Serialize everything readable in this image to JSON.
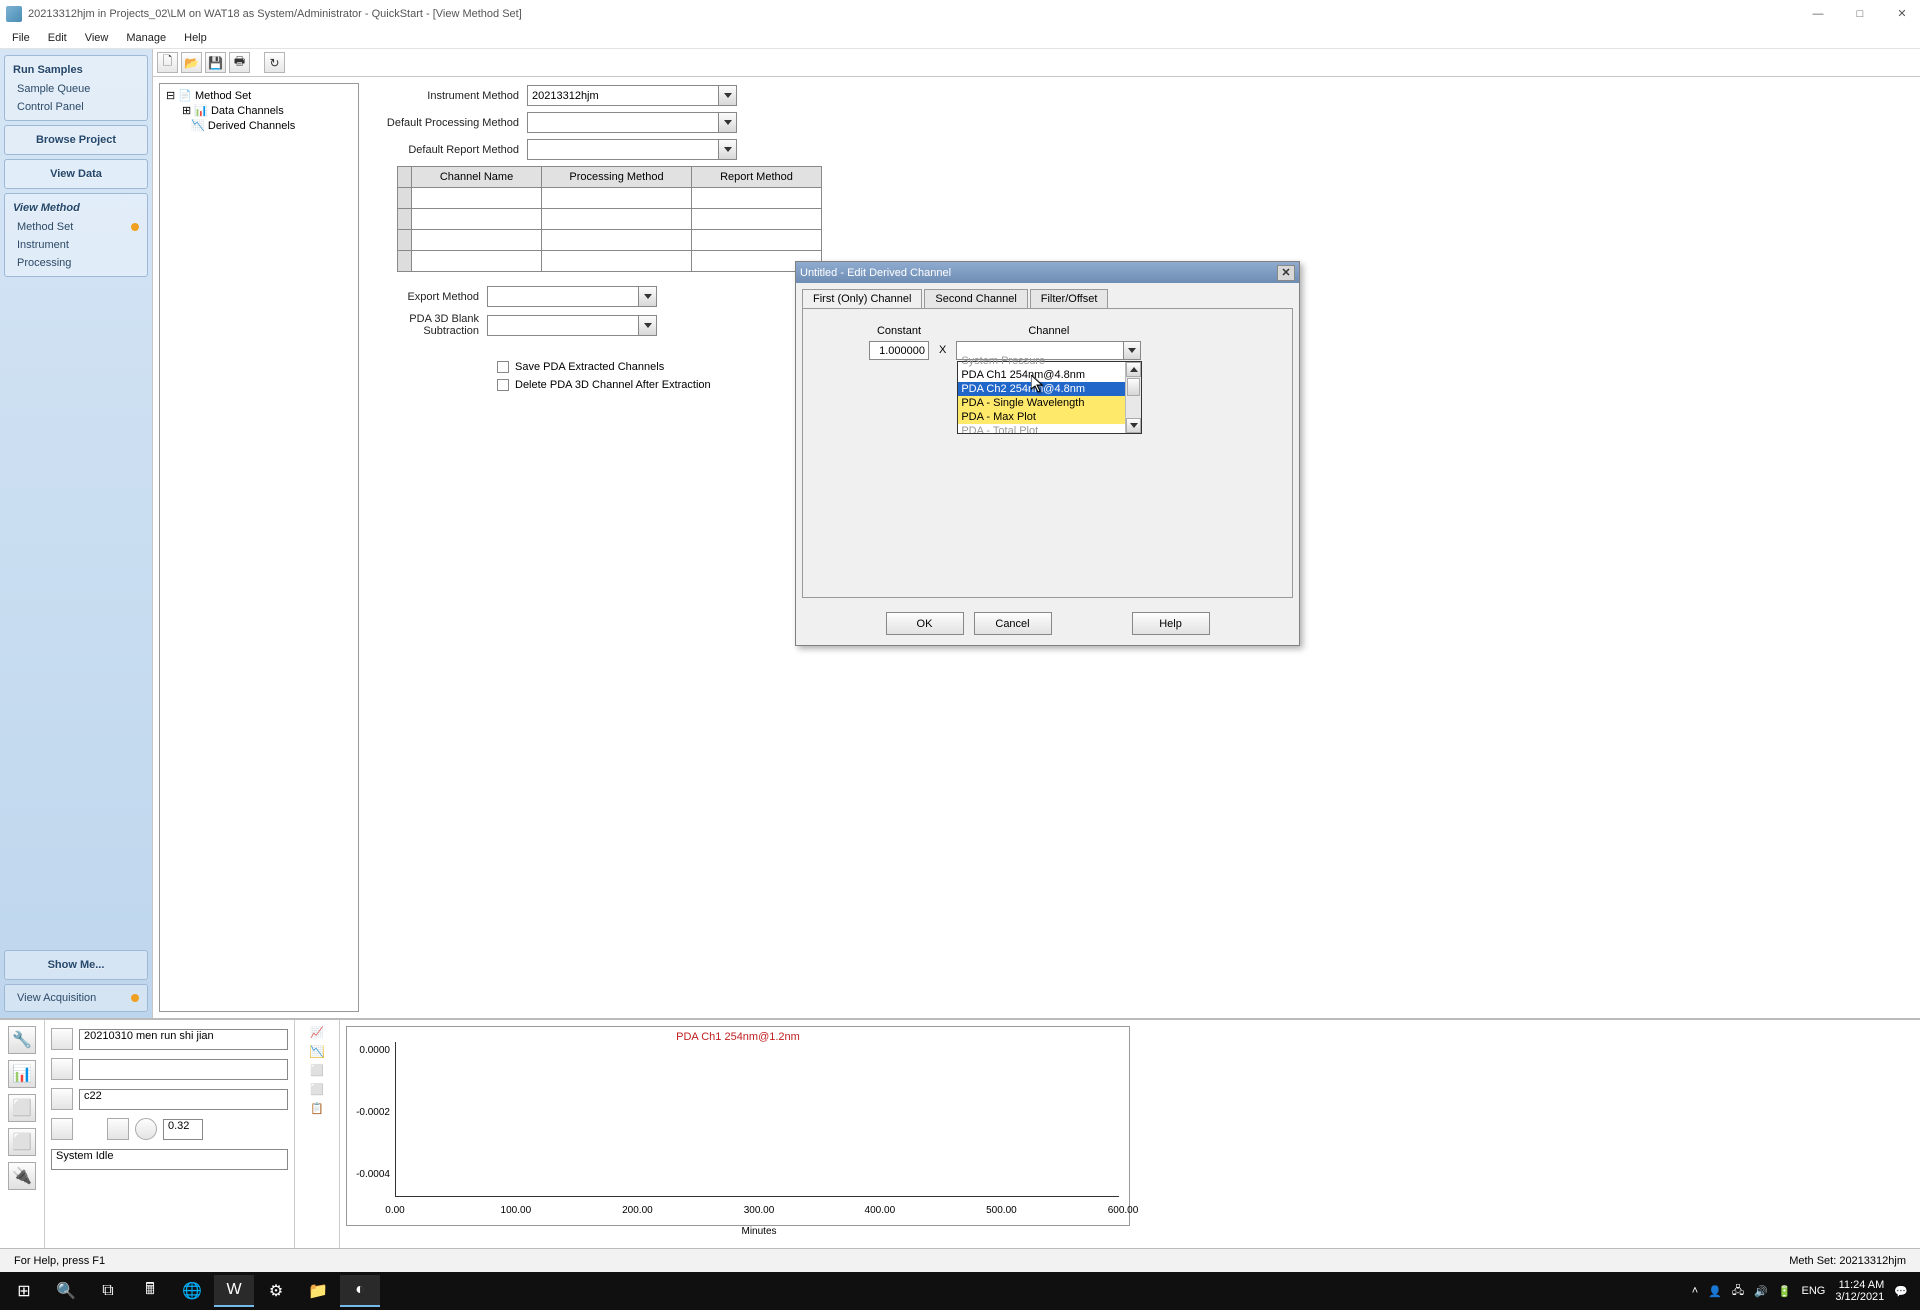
{
  "app": {
    "title": "20213312hjm in Projects_02\\LM on WAT18 as System/Administrator - QuickStart - [View Method Set]",
    "menu": [
      "File",
      "Edit",
      "View",
      "Manage",
      "Help"
    ]
  },
  "nav": {
    "runSamples": "Run Samples",
    "sampleQueue": "Sample Queue",
    "controlPanel": "Control Panel",
    "browseProject": "Browse Project",
    "viewData": "View Data",
    "viewMethod": "View Method",
    "methodSet": "Method Set",
    "instrument": "Instrument",
    "processing": "Processing",
    "showMe": "Show Me...",
    "viewAcq": "View Acquisition"
  },
  "tree": {
    "root": "Method Set",
    "child1": "Data Channels",
    "child2": "Derived Channels"
  },
  "form": {
    "im_label": "Instrument Method",
    "im_value": "20213312hjm",
    "dpm_label": "Default Processing Method",
    "drm_label": "Default Report Method",
    "col_chan": "Channel Name",
    "col_proc": "Processing Method",
    "col_rep": "Report Method",
    "export_label": "Export Method",
    "pda_label": "PDA 3D Blank Subtraction",
    "chk1": "Save PDA Extracted Channels",
    "chk2": "Delete PDA 3D Channel After Extraction"
  },
  "dialog": {
    "title": "Untitled - Edit Derived Channel",
    "tab1": "First (Only) Channel",
    "tab2": "Second Channel",
    "tab3": "Filter/Offset",
    "constant_label": "Constant",
    "constant_value": "1.000000",
    "x": "X",
    "channel_label": "Channel",
    "options": {
      "o0": "System Pressure",
      "o1": "PDA Ch1 254nm@4.8nm",
      "o2": "PDA Ch2 254nm@4.8nm",
      "o3": "PDA - Single Wavelength",
      "o4": "PDA - Max Plot",
      "o5": "PDA - Total Plot"
    },
    "ok": "OK",
    "cancel": "Cancel",
    "help": "Help"
  },
  "bottom": {
    "sample": "20210310 men run shi jian",
    "czz": "c22",
    "tval": "0.32",
    "idle": "System Idle"
  },
  "chart_data": {
    "type": "line",
    "title": "PDA Ch1 254nm@1.2nm",
    "xlabel": "Minutes",
    "ylabel": "",
    "xlim": [
      0,
      600
    ],
    "ylim": [
      -0.0004,
      0.0001
    ],
    "xticks": [
      0,
      100,
      200,
      300,
      400,
      500,
      600
    ],
    "xticklabels": [
      "0.00",
      "100.00",
      "200.00",
      "300.00",
      "400.00",
      "500.00",
      "600.00"
    ],
    "yticks": [
      0.0,
      -0.0002,
      -0.0004
    ],
    "yticklabels": [
      "0.0000",
      "-0.0002",
      "-0.0004"
    ],
    "series": [
      {
        "name": "PDA Ch1 254nm@1.2nm",
        "x": [],
        "y": []
      }
    ]
  },
  "status": {
    "help": "For Help, press F1",
    "methset": "Meth Set: 20213312hjm"
  },
  "tray": {
    "time": "11:24 AM",
    "date": "3/12/2021"
  }
}
